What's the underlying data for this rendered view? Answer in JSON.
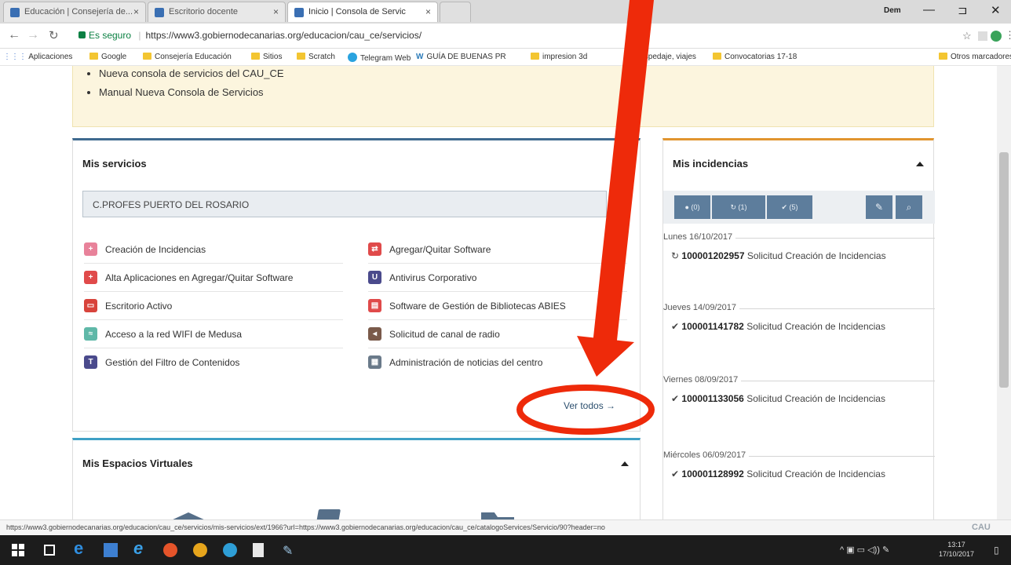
{
  "browser": {
    "tabs": [
      {
        "label": "Educación | Consejería de..."
      },
      {
        "label": "Escritorio docente"
      },
      {
        "label": "Inicio | Consola de Servic"
      }
    ],
    "user": "Dem",
    "url": "https://www3.gobiernodecanarias.org/educacion/cau_ce/servicios/",
    "secure_label": "Es seguro",
    "bookmarks": [
      "Aplicaciones",
      "Google",
      "Consejería Educación",
      "Sitios",
      "Scratch",
      "Telegram Web",
      "GUÍA DE BUENAS PR",
      "impresion 3d",
      "Hospedaje, viajes",
      "Convocatorias 17-18",
      "Otros marcadores"
    ]
  },
  "notice": {
    "items": [
      "Nueva consola de servicios del CAU_CE",
      "Manual Nueva Consola de Servicios"
    ]
  },
  "mis_servicios": {
    "title": "Mis servicios",
    "center": "C.PROFES PUERTO DEL ROSARIO",
    "services": [
      {
        "label": "Creación de Incidencias",
        "color": "#e8829a",
        "glyph": "+"
      },
      {
        "label": "Agregar/Quitar Software",
        "color": "#e04a4a",
        "glyph": "⇄"
      },
      {
        "label": "Alta Aplicaciones en Agregar/Quitar Software",
        "color": "#e04a4a",
        "glyph": "+"
      },
      {
        "label": "Antivirus Corporativo",
        "color": "#4a4a8c",
        "glyph": "U"
      },
      {
        "label": "Escritorio Activo",
        "color": "#d8443c",
        "glyph": "▭"
      },
      {
        "label": "Software de Gestión de Bibliotecas ABIES",
        "color": "#e04a4a",
        "glyph": "▤"
      },
      {
        "label": "Acceso a la red WIFI de Medusa",
        "color": "#5fb8a8",
        "glyph": "≈"
      },
      {
        "label": "Solicitud de canal de radio",
        "color": "#7a5a4a",
        "glyph": "◂"
      },
      {
        "label": "Gestión del Filtro de Contenidos",
        "color": "#4a4a8c",
        "glyph": "T"
      },
      {
        "label": "Administración de noticias del centro",
        "color": "#6a7a8a",
        "glyph": "▦"
      }
    ],
    "ver_todos": "Ver todos →"
  },
  "espacios": {
    "title": "Mis Espacios Virtuales"
  },
  "incidencias": {
    "title": "Mis incidencias",
    "buttons": {
      "b1": "(0)",
      "b2": "(1)",
      "b3": "(5)"
    },
    "groups": [
      {
        "date": "Lunes 16/10/2017",
        "icon": "↻",
        "number": "100001202957",
        "desc": "Solicitud Creación de Incidencias"
      },
      {
        "date": "Jueves 14/09/2017",
        "icon": "✔",
        "number": "100001141782",
        "desc": "Solicitud Creación de Incidencias"
      },
      {
        "date": "Viernes 08/09/2017",
        "icon": "✔",
        "number": "100001133056",
        "desc": "Solicitud Creación de Incidencias"
      },
      {
        "date": "Miércoles 06/09/2017",
        "icon": "✔",
        "number": "100001128992",
        "desc": "Solicitud Creación de Incidencias"
      }
    ]
  },
  "status": {
    "text": "https://www3.gobiernodecanarias.org/educacion/cau_ce/servicios/mis-servicios/ext/1966?url=https://www3.gobiernodecanarias.org/educacion/cau_ce/catalogoServices/Servicio/90?header=no",
    "logo": "CAU"
  },
  "taskbar": {
    "time": "13:17",
    "date": "17/10/2017"
  },
  "colors": {
    "annotation": "#ee2a0a",
    "accent_blue": "#3f6a8f",
    "accent_orange": "#e1952f"
  }
}
